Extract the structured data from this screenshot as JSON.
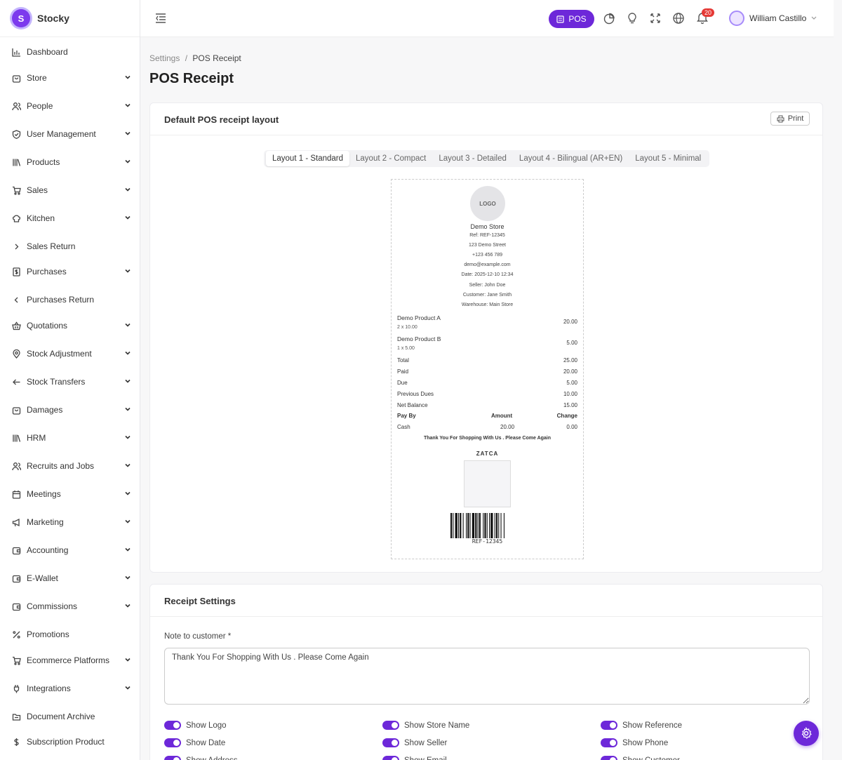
{
  "app": {
    "name": "Stocky",
    "logo_letter": "S",
    "accent": "#6d28d9"
  },
  "sidebar": {
    "items": [
      {
        "label": "Dashboard",
        "icon": "chart-bar-icon",
        "chevron": "none"
      },
      {
        "label": "Store",
        "icon": "store-bag-icon",
        "chevron": "down"
      },
      {
        "label": "People",
        "icon": "users-icon",
        "chevron": "down"
      },
      {
        "label": "User Management",
        "icon": "shield-icon",
        "chevron": "down"
      },
      {
        "label": "Products",
        "icon": "books-icon",
        "chevron": "down"
      },
      {
        "label": "Sales",
        "icon": "cart-icon",
        "chevron": "down"
      },
      {
        "label": "Kitchen",
        "icon": "chef-hat-icon",
        "chevron": "down"
      },
      {
        "label": "Sales Return",
        "icon": "chevron-right-icon",
        "chevron": "none"
      },
      {
        "label": "Purchases",
        "icon": "invoice-dollar-icon",
        "chevron": "down"
      },
      {
        "label": "Purchases Return",
        "icon": "chevron-left-icon",
        "chevron": "none"
      },
      {
        "label": "Quotations",
        "icon": "basket-icon",
        "chevron": "down"
      },
      {
        "label": "Stock Adjustment",
        "icon": "map-pin-icon",
        "chevron": "down"
      },
      {
        "label": "Stock Transfers",
        "icon": "arrow-left-icon",
        "chevron": "down"
      },
      {
        "label": "Damages",
        "icon": "bag-icon",
        "chevron": "down"
      },
      {
        "label": "HRM",
        "icon": "library-icon",
        "chevron": "down"
      },
      {
        "label": "Recruits and Jobs",
        "icon": "user-group-icon",
        "chevron": "down"
      },
      {
        "label": "Meetings",
        "icon": "calendar-icon",
        "chevron": "down"
      },
      {
        "label": "Marketing",
        "icon": "megaphone-icon",
        "chevron": "down"
      },
      {
        "label": "Accounting",
        "icon": "wallet-icon",
        "chevron": "down"
      },
      {
        "label": "E-Wallet",
        "icon": "wallet-icon",
        "chevron": "down"
      },
      {
        "label": "Commissions",
        "icon": "wallet-icon",
        "chevron": "down"
      },
      {
        "label": "Promotions",
        "icon": "percent-icon",
        "chevron": "none"
      },
      {
        "label": "Ecommerce Platforms",
        "icon": "cart-icon",
        "chevron": "down"
      },
      {
        "label": "Integrations",
        "icon": "plug-icon",
        "chevron": "down"
      },
      {
        "label": "Document Archive",
        "icon": "folder-icon",
        "chevron": "none"
      },
      {
        "label": "Subscription Product",
        "icon": "dollar-icon",
        "chevron": "none"
      }
    ]
  },
  "header": {
    "pos_label": "POS",
    "notification_count": "20",
    "user_name": "William Castillo"
  },
  "breadcrumb": {
    "parent": "Settings",
    "separator": "/",
    "current": "POS Receipt"
  },
  "page_title": "POS Receipt",
  "layout_card": {
    "title": "Default POS receipt layout",
    "print_label": "Print",
    "tabs": [
      "Layout 1 - Standard",
      "Layout 2 - Compact",
      "Layout 3 - Detailed",
      "Layout 4 - Bilingual (AR+EN)",
      "Layout 5 - Minimal"
    ],
    "active_tab": 0
  },
  "receipt": {
    "logo_text": "LOGO",
    "store_name": "Demo Store",
    "info_lines": [
      "Ref: REF-12345",
      "123 Demo Street",
      "+123 456 789",
      "demo@example.com",
      "Date: 2025-12-10 12:34",
      "Seller: John Doe",
      "Customer: Jane Smith",
      "Warehouse: Main Store"
    ],
    "products": [
      {
        "name": "Demo Product A",
        "qty_price": "2 x 10.00",
        "total": "20.00"
      },
      {
        "name": "Demo Product B",
        "qty_price": "1 x 5.00",
        "total": "5.00"
      }
    ],
    "totals": [
      {
        "label": "Total",
        "value": "25.00"
      },
      {
        "label": "Paid",
        "value": "20.00"
      },
      {
        "label": "Due",
        "value": "5.00"
      },
      {
        "label": "Previous Dues",
        "value": "10.00"
      },
      {
        "label": "Net Balance",
        "value": "15.00"
      }
    ],
    "payment_headers": {
      "pay_by": "Pay By",
      "amount": "Amount",
      "change": "Change"
    },
    "payment_row": {
      "pay_by": "Cash",
      "amount": "20.00",
      "change": "0.00"
    },
    "footer_note": "Thank You For Shopping With Us . Please Come Again",
    "zatca_label": "ZATCA",
    "barcode_text": "REF-12345"
  },
  "settings_card": {
    "title": "Receipt Settings",
    "note_label": "Note to customer *",
    "note_value": "Thank You For Shopping With Us . Please Come Again",
    "toggles": [
      {
        "label": "Show Logo",
        "on": true
      },
      {
        "label": "Show Store Name",
        "on": true
      },
      {
        "label": "Show Reference",
        "on": true
      },
      {
        "label": "Show Date",
        "on": true
      },
      {
        "label": "Show Seller",
        "on": true
      },
      {
        "label": "Show Phone",
        "on": true
      },
      {
        "label": "Show Address",
        "on": true
      },
      {
        "label": "Show Email",
        "on": true
      },
      {
        "label": "Show Customer",
        "on": true
      }
    ]
  }
}
